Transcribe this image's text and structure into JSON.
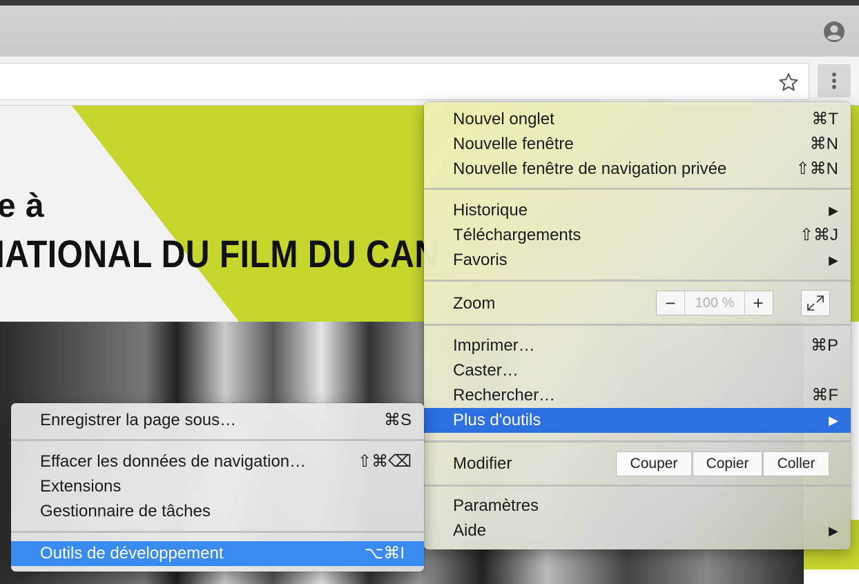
{
  "banner": {
    "line1": "e à",
    "line2": "NATIONAL DU FILM DU CAN"
  },
  "colors": {
    "accent_green": "#c5d62d",
    "menu_highlight": "#2d6fe0"
  },
  "icons": {
    "profile": "profile-icon",
    "bookmark": "star-icon",
    "menu": "more-vert-icon",
    "fullscreen": "fullscreen-icon"
  },
  "main_menu": {
    "new_tab": {
      "label": "Nouvel onglet",
      "shortcut": "⌘T"
    },
    "new_window": {
      "label": "Nouvelle fenêtre",
      "shortcut": "⌘N"
    },
    "new_private_window": {
      "label": "Nouvelle fenêtre de navigation privée",
      "shortcut": "⇧⌘N"
    },
    "history": {
      "label": "Historique",
      "arrow": "▶"
    },
    "downloads": {
      "label": "Téléchargements",
      "shortcut": "⇧⌘J"
    },
    "bookmarks": {
      "label": "Favoris",
      "arrow": "▶"
    },
    "zoom": {
      "label": "Zoom",
      "minus": "−",
      "value": "100 %",
      "plus": "+"
    },
    "print": {
      "label": "Imprimer…",
      "shortcut": "⌘P"
    },
    "cast": {
      "label": "Caster…"
    },
    "find": {
      "label": "Rechercher…",
      "shortcut": "⌘F"
    },
    "more_tools": {
      "label": "Plus d'outils",
      "arrow": "▶"
    },
    "edit": {
      "label": "Modifier",
      "cut": "Couper",
      "copy": "Copier",
      "paste": "Coller"
    },
    "settings": {
      "label": "Paramètres"
    },
    "help": {
      "label": "Aide",
      "arrow": "▶"
    }
  },
  "sub_menu": {
    "save_page": {
      "label": "Enregistrer la page sous…",
      "shortcut": "⌘S"
    },
    "clear_data": {
      "label": "Effacer les données de navigation…",
      "shortcut": "⇧⌘⌫"
    },
    "extensions": {
      "label": "Extensions"
    },
    "task_manager": {
      "label": "Gestionnaire de tâches"
    },
    "dev_tools": {
      "label": "Outils de développement",
      "shortcut": "⌥⌘I"
    }
  }
}
